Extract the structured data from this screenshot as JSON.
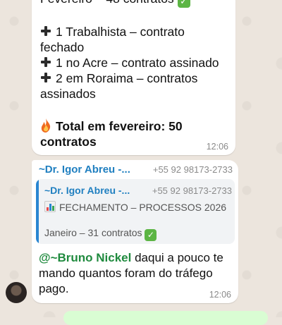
{
  "message1": {
    "partial_top": "Fevereiro – 48 contratos",
    "items": [
      "1 Trabalhista – contrato",
      "fechado",
      "1 no Acre – contrato assinado",
      "2 em Roraima – contratos",
      "assinados"
    ],
    "total_line1": "Total em fevereiro: 50",
    "total_line2": "contratos",
    "time": "12:06"
  },
  "message2": {
    "sender_name": "~Dr. Igor Abreu -...",
    "sender_phone": "+55 92 98173-2733",
    "quote": {
      "sender_name": "~Dr. Igor Abreu -...",
      "sender_phone": "+55 92 98173-2733",
      "title": "FECHAMENTO – PROCESSOS 2026",
      "line": "Janeiro – 31 contratos"
    },
    "mention": "@~Bruno Nickel",
    "text_line1": " daqui a pouco te",
    "text_line2": "mando quantos foram do tráfego",
    "text_line3": "pago.",
    "time": "12:06"
  }
}
